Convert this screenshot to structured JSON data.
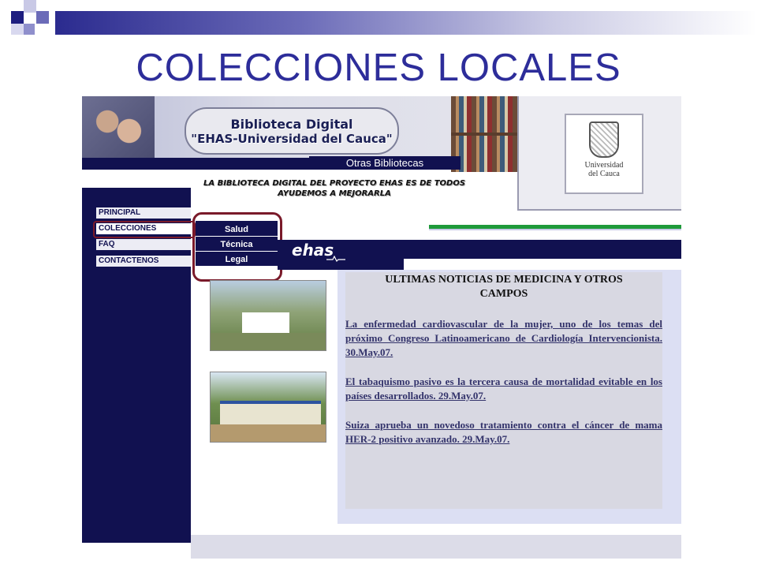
{
  "slide": {
    "title": "COLECCIONES LOCALES"
  },
  "header": {
    "logo_line1": "Biblioteca Digital",
    "logo_line2": "\"EHAS-Universidad del Cauca\"",
    "other_libraries": "Otras Bibliotecas",
    "tagline_line1": "LA BIBLIOTECA DIGITAL DEL PROYECTO EHAS ES DE TODOS",
    "tagline_line2": "AYUDEMOS A MEJORARLA",
    "university_line1": "Universidad",
    "university_line2": "del Cauca"
  },
  "sidebar": {
    "items": [
      {
        "label": "PRINCIPAL"
      },
      {
        "label": "COLECCIONES"
      },
      {
        "label": "FAQ"
      },
      {
        "label": "CONTACTENOS"
      }
    ]
  },
  "submenu": {
    "items": [
      {
        "label": "Salud"
      },
      {
        "label": "Técnica"
      },
      {
        "label": "Legal"
      }
    ]
  },
  "banner": {
    "logo": "ehas"
  },
  "news": {
    "title_line1": "ULTIMAS NOTICIAS DE MEDICINA Y OTROS",
    "title_line2": "CAMPOS",
    "items": [
      {
        "text": "La enfermedad cardiovascular de la mujer, uno de los temas del próximo Congreso Latinoamericano de Cardiología Intervencionista. 30.May.07."
      },
      {
        "text": "El tabaquismo pasivo es la tercera causa de mortalidad evitable en los países desarrollados. 29.May.07."
      },
      {
        "text": "Suiza aprueba un novedoso tratamiento contra el cáncer de mama HER-2 positivo avanzado. 29.May.07."
      }
    ]
  },
  "colors": {
    "navy": "#111150",
    "title_blue": "#2d2d9a",
    "highlight": "#7a1a2a",
    "green": "#1f9a3a"
  }
}
